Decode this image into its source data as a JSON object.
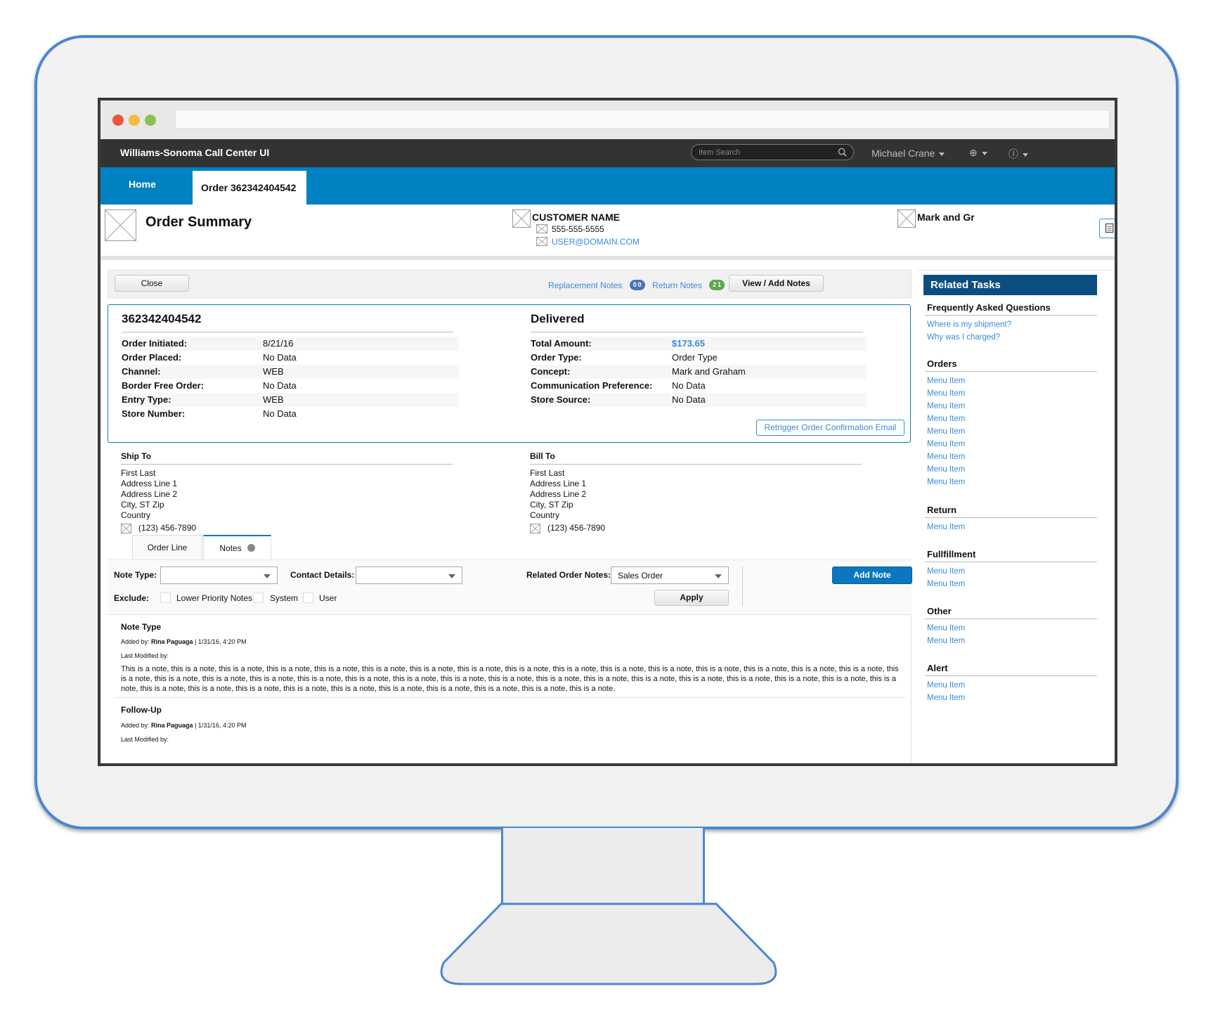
{
  "browser": {
    "dots": [
      "#e9573f",
      "#f6bb42",
      "#8cc152"
    ]
  },
  "topnav": {
    "app_title": "Williams-Sonoma Call Center UI",
    "search_placeholder": "Item Search",
    "user_name": "Michael Crane"
  },
  "tabs": {
    "home": "Home",
    "order": "Order 362342404542"
  },
  "header": {
    "title": "Order Summary",
    "customer_name": "CUSTOMER NAME",
    "phone": "555-555-5555",
    "email": "USER@DOMAIN.COM",
    "concept": "Mark and Gr"
  },
  "actions": {
    "close": "Close",
    "replacement_notes": "Replacement Notes",
    "replacement_counts": [
      "0",
      "0"
    ],
    "return_notes": "Return Notes",
    "return_counts": [
      "2",
      "1"
    ],
    "view_add_notes": "View / Add Notes"
  },
  "summary": {
    "order_number": "362342404542",
    "status": "Delivered",
    "left": [
      {
        "label": "Order Initiated:",
        "value": "8/21/16"
      },
      {
        "label": "Order Placed:",
        "value": "No Data"
      },
      {
        "label": "Channel:",
        "value": "WEB"
      },
      {
        "label": "Border Free Order:",
        "value": "No Data"
      },
      {
        "label": "Entry Type:",
        "value": "WEB"
      },
      {
        "label": "Store Number:",
        "value": "No Data"
      }
    ],
    "right": [
      {
        "label": "Total Amount:",
        "value": "$173.65"
      },
      {
        "label": "Order Type:",
        "value": "Order Type"
      },
      {
        "label": "Concept:",
        "value": "Mark and Graham"
      },
      {
        "label": "Communication Preference:",
        "value": "No Data"
      },
      {
        "label": "Store Source:",
        "value": "No Data"
      }
    ],
    "retrigger": "Retrigger Order Confirmation Email"
  },
  "ship_to": {
    "heading": "Ship To",
    "lines": [
      "First Last",
      "Address Line 1",
      "Address Line 2",
      "City, ST Zip",
      "Country"
    ],
    "phone": "(123) 456-7890"
  },
  "bill_to": {
    "heading": "Bill To",
    "lines": [
      "First Last",
      "Address Line 1",
      "Address Line 2",
      "City, ST Zip",
      "Country"
    ],
    "phone": "(123) 456-7890"
  },
  "note_tabs": {
    "order_line": "Order Line",
    "notes": "Notes"
  },
  "filters": {
    "note_type_label": "Note Type:",
    "contact_details_label": "Contact Details:",
    "related_order_notes_label": "Related Order Notes:",
    "related_order_notes_value": "Sales Order",
    "add_note": "Add Note",
    "exclude_label": "Exclude:",
    "exclude_options": [
      "Lower Priority Notes",
      "System",
      "User"
    ],
    "apply": "Apply"
  },
  "notes": [
    {
      "title": "Note Type",
      "added_by_label": "Added by:",
      "added_by": "Rina Paguaga",
      "added_meta": "| 1/31/16, 4:20 PM",
      "modified_label": "Last Modified by:",
      "body": "This is a note, this is a note, this is a note, this is a note, this is a note, this is a note, this is a note, this is a note, this is a note, this is a note, this is a note, this is a note, this is a note, this is a note, this is a note, this is a note, this is a note, this is a note, this is a note, this is a note, this is a note, this is a note, this is a note, this is a note, this is a note, this is a note, this is a note, this is a note, this is a note, this is a note, this is a note, this is a note, this is a note, this is a note, this is a note, this is a note, this is a note, this is a note, this is a note, this is a note, this is a note, this is a note, this is a note."
    },
    {
      "title": "Follow-Up",
      "added_by_label": "Added by:",
      "added_by": "Rina Paguaga",
      "added_meta": "| 1/31/16, 4:20 PM",
      "modified_label": "Last Modified by:"
    }
  ],
  "related": {
    "title": "Related Tasks",
    "sections": [
      {
        "name": "Frequently Asked Questions",
        "items": [
          "Where is my shipment?",
          "Why was I charged?"
        ]
      },
      {
        "name": "Orders",
        "items": [
          "Menu Item",
          "Menu Item",
          "Menu Item",
          "Menu Item",
          "Menu Item",
          "Menu Item",
          "Menu Item",
          "Menu Item",
          "Menu Item"
        ]
      },
      {
        "name": "Return",
        "items": [
          "Menu Item"
        ]
      },
      {
        "name": "Fullfillment",
        "items": [
          "Menu Item",
          "Menu Item"
        ]
      },
      {
        "name": "Other",
        "items": [
          "Menu Item",
          "Menu Item"
        ]
      },
      {
        "name": "Alert",
        "items": [
          "Menu Item",
          "Menu Item"
        ]
      }
    ]
  }
}
